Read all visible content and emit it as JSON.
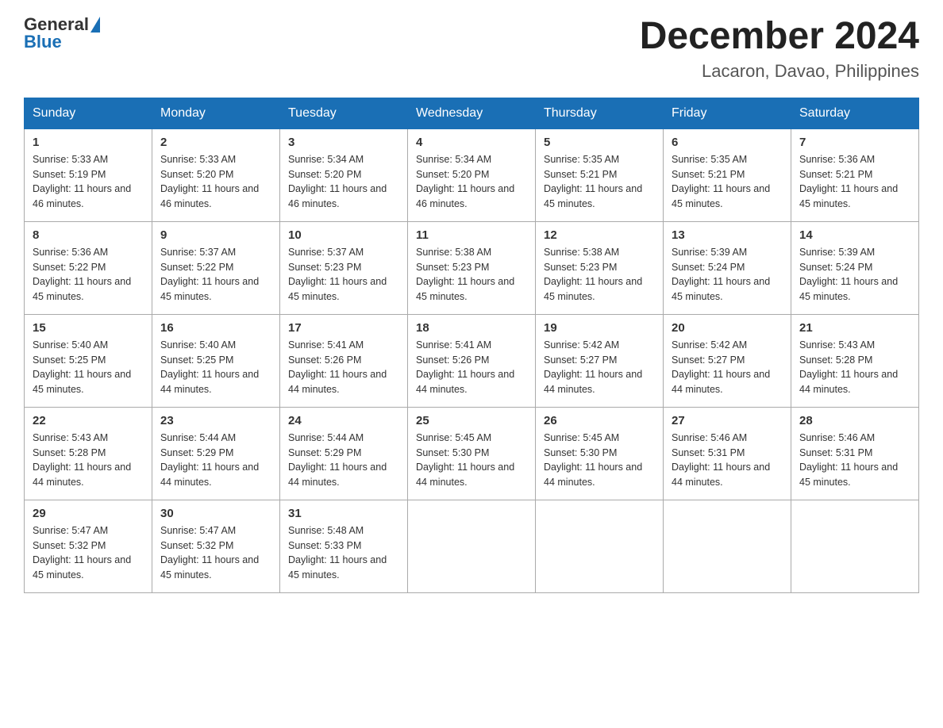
{
  "header": {
    "logo_general": "General",
    "logo_blue": "Blue",
    "title": "December 2024",
    "subtitle": "Lacaron, Davao, Philippines"
  },
  "weekdays": [
    "Sunday",
    "Monday",
    "Tuesday",
    "Wednesday",
    "Thursday",
    "Friday",
    "Saturday"
  ],
  "weeks": [
    [
      {
        "day": "1",
        "sunrise": "Sunrise: 5:33 AM",
        "sunset": "Sunset: 5:19 PM",
        "daylight": "Daylight: 11 hours and 46 minutes."
      },
      {
        "day": "2",
        "sunrise": "Sunrise: 5:33 AM",
        "sunset": "Sunset: 5:20 PM",
        "daylight": "Daylight: 11 hours and 46 minutes."
      },
      {
        "day": "3",
        "sunrise": "Sunrise: 5:34 AM",
        "sunset": "Sunset: 5:20 PM",
        "daylight": "Daylight: 11 hours and 46 minutes."
      },
      {
        "day": "4",
        "sunrise": "Sunrise: 5:34 AM",
        "sunset": "Sunset: 5:20 PM",
        "daylight": "Daylight: 11 hours and 46 minutes."
      },
      {
        "day": "5",
        "sunrise": "Sunrise: 5:35 AM",
        "sunset": "Sunset: 5:21 PM",
        "daylight": "Daylight: 11 hours and 45 minutes."
      },
      {
        "day": "6",
        "sunrise": "Sunrise: 5:35 AM",
        "sunset": "Sunset: 5:21 PM",
        "daylight": "Daylight: 11 hours and 45 minutes."
      },
      {
        "day": "7",
        "sunrise": "Sunrise: 5:36 AM",
        "sunset": "Sunset: 5:21 PM",
        "daylight": "Daylight: 11 hours and 45 minutes."
      }
    ],
    [
      {
        "day": "8",
        "sunrise": "Sunrise: 5:36 AM",
        "sunset": "Sunset: 5:22 PM",
        "daylight": "Daylight: 11 hours and 45 minutes."
      },
      {
        "day": "9",
        "sunrise": "Sunrise: 5:37 AM",
        "sunset": "Sunset: 5:22 PM",
        "daylight": "Daylight: 11 hours and 45 minutes."
      },
      {
        "day": "10",
        "sunrise": "Sunrise: 5:37 AM",
        "sunset": "Sunset: 5:23 PM",
        "daylight": "Daylight: 11 hours and 45 minutes."
      },
      {
        "day": "11",
        "sunrise": "Sunrise: 5:38 AM",
        "sunset": "Sunset: 5:23 PM",
        "daylight": "Daylight: 11 hours and 45 minutes."
      },
      {
        "day": "12",
        "sunrise": "Sunrise: 5:38 AM",
        "sunset": "Sunset: 5:23 PM",
        "daylight": "Daylight: 11 hours and 45 minutes."
      },
      {
        "day": "13",
        "sunrise": "Sunrise: 5:39 AM",
        "sunset": "Sunset: 5:24 PM",
        "daylight": "Daylight: 11 hours and 45 minutes."
      },
      {
        "day": "14",
        "sunrise": "Sunrise: 5:39 AM",
        "sunset": "Sunset: 5:24 PM",
        "daylight": "Daylight: 11 hours and 45 minutes."
      }
    ],
    [
      {
        "day": "15",
        "sunrise": "Sunrise: 5:40 AM",
        "sunset": "Sunset: 5:25 PM",
        "daylight": "Daylight: 11 hours and 45 minutes."
      },
      {
        "day": "16",
        "sunrise": "Sunrise: 5:40 AM",
        "sunset": "Sunset: 5:25 PM",
        "daylight": "Daylight: 11 hours and 44 minutes."
      },
      {
        "day": "17",
        "sunrise": "Sunrise: 5:41 AM",
        "sunset": "Sunset: 5:26 PM",
        "daylight": "Daylight: 11 hours and 44 minutes."
      },
      {
        "day": "18",
        "sunrise": "Sunrise: 5:41 AM",
        "sunset": "Sunset: 5:26 PM",
        "daylight": "Daylight: 11 hours and 44 minutes."
      },
      {
        "day": "19",
        "sunrise": "Sunrise: 5:42 AM",
        "sunset": "Sunset: 5:27 PM",
        "daylight": "Daylight: 11 hours and 44 minutes."
      },
      {
        "day": "20",
        "sunrise": "Sunrise: 5:42 AM",
        "sunset": "Sunset: 5:27 PM",
        "daylight": "Daylight: 11 hours and 44 minutes."
      },
      {
        "day": "21",
        "sunrise": "Sunrise: 5:43 AM",
        "sunset": "Sunset: 5:28 PM",
        "daylight": "Daylight: 11 hours and 44 minutes."
      }
    ],
    [
      {
        "day": "22",
        "sunrise": "Sunrise: 5:43 AM",
        "sunset": "Sunset: 5:28 PM",
        "daylight": "Daylight: 11 hours and 44 minutes."
      },
      {
        "day": "23",
        "sunrise": "Sunrise: 5:44 AM",
        "sunset": "Sunset: 5:29 PM",
        "daylight": "Daylight: 11 hours and 44 minutes."
      },
      {
        "day": "24",
        "sunrise": "Sunrise: 5:44 AM",
        "sunset": "Sunset: 5:29 PM",
        "daylight": "Daylight: 11 hours and 44 minutes."
      },
      {
        "day": "25",
        "sunrise": "Sunrise: 5:45 AM",
        "sunset": "Sunset: 5:30 PM",
        "daylight": "Daylight: 11 hours and 44 minutes."
      },
      {
        "day": "26",
        "sunrise": "Sunrise: 5:45 AM",
        "sunset": "Sunset: 5:30 PM",
        "daylight": "Daylight: 11 hours and 44 minutes."
      },
      {
        "day": "27",
        "sunrise": "Sunrise: 5:46 AM",
        "sunset": "Sunset: 5:31 PM",
        "daylight": "Daylight: 11 hours and 44 minutes."
      },
      {
        "day": "28",
        "sunrise": "Sunrise: 5:46 AM",
        "sunset": "Sunset: 5:31 PM",
        "daylight": "Daylight: 11 hours and 45 minutes."
      }
    ],
    [
      {
        "day": "29",
        "sunrise": "Sunrise: 5:47 AM",
        "sunset": "Sunset: 5:32 PM",
        "daylight": "Daylight: 11 hours and 45 minutes."
      },
      {
        "day": "30",
        "sunrise": "Sunrise: 5:47 AM",
        "sunset": "Sunset: 5:32 PM",
        "daylight": "Daylight: 11 hours and 45 minutes."
      },
      {
        "day": "31",
        "sunrise": "Sunrise: 5:48 AM",
        "sunset": "Sunset: 5:33 PM",
        "daylight": "Daylight: 11 hours and 45 minutes."
      },
      null,
      null,
      null,
      null
    ]
  ]
}
